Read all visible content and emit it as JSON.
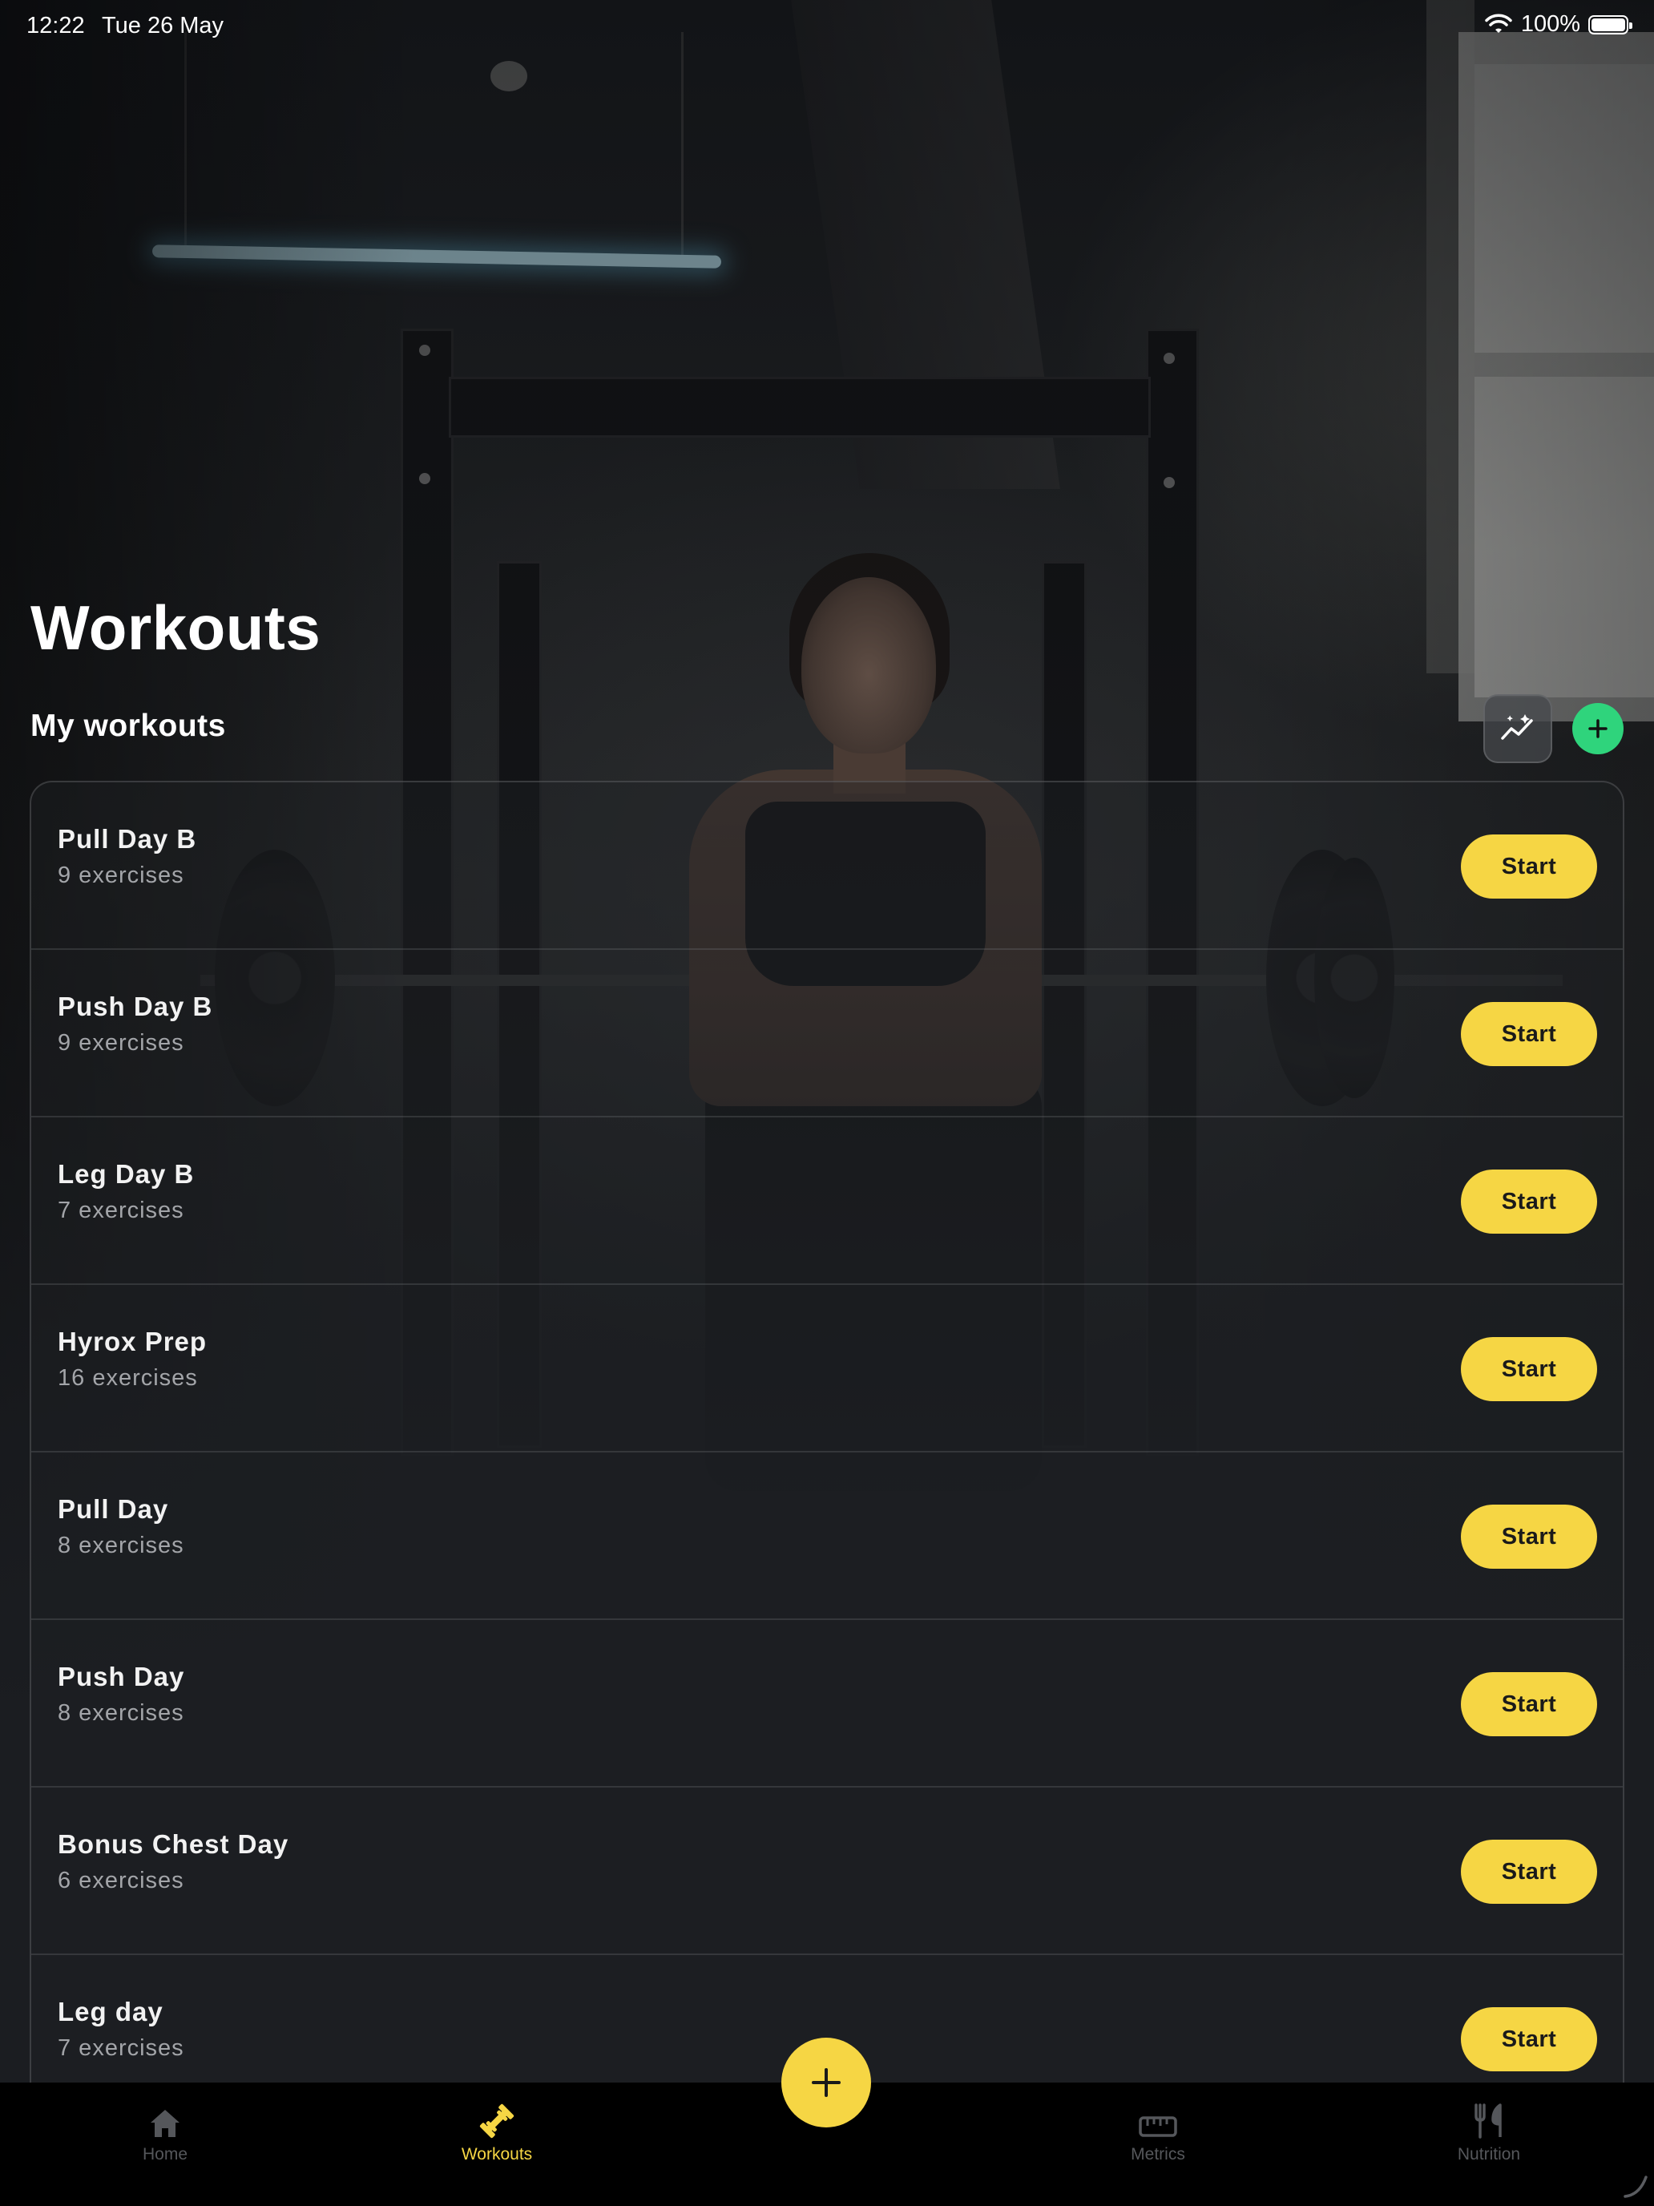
{
  "status_bar": {
    "time": "12:22",
    "date": "Tue 26 May",
    "battery": "100%",
    "icons": [
      "wifi-icon",
      "battery-icon"
    ]
  },
  "header": {
    "title": "Workouts",
    "section_title": "My workouts",
    "actions": [
      "insights-icon",
      "plus-icon"
    ]
  },
  "workouts": [
    {
      "name": "Pull Day B",
      "count": "9 exercises",
      "action": "Start"
    },
    {
      "name": "Push Day B",
      "count": "9 exercises",
      "action": "Start"
    },
    {
      "name": "Leg Day B",
      "count": "7 exercises",
      "action": "Start"
    },
    {
      "name": "Hyrox Prep",
      "count": "16 exercises",
      "action": "Start"
    },
    {
      "name": "Pull Day",
      "count": "8 exercises",
      "action": "Start"
    },
    {
      "name": "Push Day",
      "count": "8 exercises",
      "action": "Start"
    },
    {
      "name": "Bonus Chest Day",
      "count": "6 exercises",
      "action": "Start"
    },
    {
      "name": "Leg day",
      "count": "7 exercises",
      "action": "Start"
    }
  ],
  "tabbar": {
    "tabs": [
      {
        "label": "Home",
        "icon": "house-icon",
        "active": false
      },
      {
        "label": "Workouts",
        "icon": "dumbbell-icon",
        "active": true
      },
      {
        "label": "Metrics",
        "icon": "ruler-icon",
        "active": false
      },
      {
        "label": "Nutrition",
        "icon": "fork-knife-icon",
        "active": false
      }
    ],
    "fab_icon": "plus-icon"
  },
  "colors": {
    "accent": "#f6d644",
    "add_green": "#2fd47c",
    "muted": "#a3a5a9",
    "tab_inactive": "#55575b"
  }
}
